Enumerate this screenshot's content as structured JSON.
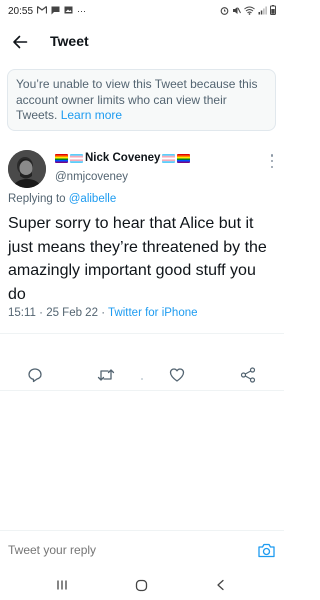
{
  "status_bar": {
    "time": "20:55",
    "left_icons": [
      "gmail-icon",
      "message-icon",
      "image-icon",
      "more-dots-icon"
    ],
    "right_icons": [
      "alarm-icon",
      "mute-icon",
      "wifi-icon",
      "signal-icon",
      "battery-icon"
    ]
  },
  "header": {
    "title": "Tweet"
  },
  "notice": {
    "text": "You’re unable to view this Tweet because this account owner limits who can view their Tweets.",
    "link": "Learn more"
  },
  "tweet": {
    "display_name": "Nick Coveney",
    "username": "@nmjcoveney",
    "reply_prefix": "Replying to",
    "reply_to": "@alibelle",
    "text": "Super sorry to hear that Alice but it just means they’re threatened by the amazingly important good stuff you do",
    "time": "15:11",
    "date": "25 Feb 22",
    "separator": "·",
    "source": "Twitter for iPhone"
  },
  "actions": [
    "reply-icon",
    "retweet-icon",
    "like-icon",
    "share-icon"
  ],
  "reply_bar": {
    "placeholder": "Tweet your reply"
  },
  "colors": {
    "accent": "#1d9bf0",
    "text": "#0f1419",
    "secondary": "#536471"
  }
}
